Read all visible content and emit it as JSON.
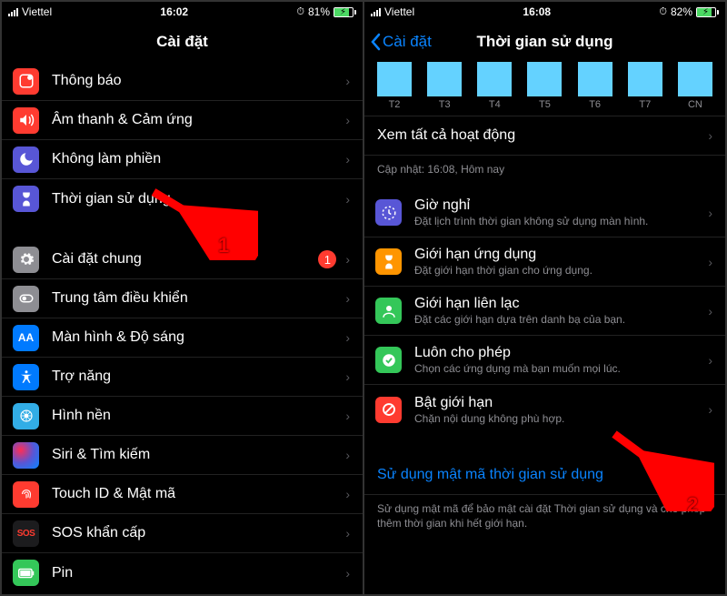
{
  "leftPhone": {
    "status": {
      "carrier": "Viettel",
      "time": "16:02",
      "battery_pct": "81%",
      "battery_fill": 81
    },
    "title": "Cài đặt",
    "group1": [
      {
        "label": "Thông báo",
        "icon": "notification-icon",
        "color": "bg-red"
      },
      {
        "label": "Âm thanh & Cảm ứng",
        "icon": "sound-icon",
        "color": "bg-red"
      },
      {
        "label": "Không làm phiền",
        "icon": "dnd-icon",
        "color": "bg-purple"
      },
      {
        "label": "Thời gian sử dụng",
        "icon": "screentime-icon",
        "color": "bg-purple"
      }
    ],
    "group2": [
      {
        "label": "Cài đặt chung",
        "icon": "gear-icon",
        "color": "bg-gray",
        "badge": "1"
      },
      {
        "label": "Trung tâm điều khiển",
        "icon": "control-icon",
        "color": "bg-gray"
      },
      {
        "label": "Màn hình & Độ sáng",
        "icon": "display-icon",
        "color": "bg-blue"
      },
      {
        "label": "Trợ năng",
        "icon": "accessibility-icon",
        "color": "bg-blue"
      },
      {
        "label": "Hình nền",
        "icon": "wallpaper-icon",
        "color": "bg-lteal"
      },
      {
        "label": "Siri & Tìm kiếm",
        "icon": "siri-icon",
        "color": "siri-icon"
      },
      {
        "label": "Touch ID & Mật mã",
        "icon": "touchid-icon",
        "color": "bg-red"
      },
      {
        "label": "SOS khẩn cấp",
        "icon": "sos-icon",
        "color": "bg-sos"
      },
      {
        "label": "Pin",
        "icon": "battery-icon",
        "color": "bg-green"
      }
    ],
    "annotation": {
      "label": "1"
    }
  },
  "rightPhone": {
    "status": {
      "carrier": "Viettel",
      "time": "16:08",
      "battery_pct": "82%",
      "battery_fill": 82
    },
    "back_label": "Cài đặt",
    "title": "Thời gian sử dụng",
    "chart": {
      "days": [
        "T2",
        "T3",
        "T4",
        "T5",
        "T6",
        "T7",
        "CN"
      ]
    },
    "view_all": "Xem tất cả hoạt động",
    "updated": "Cập nhật: 16:08, Hôm nay",
    "options": [
      {
        "label": "Giờ nghỉ",
        "sub": "Đặt lịch trình thời gian không sử dụng màn hình.",
        "icon": "downtime-icon",
        "color": "bg-purple"
      },
      {
        "label": "Giới hạn ứng dụng",
        "sub": "Đặt giới hạn thời gian cho ứng dụng.",
        "icon": "applimits-icon",
        "color": "bg-orange"
      },
      {
        "label": "Giới hạn liên lạc",
        "sub": "Đặt các giới hạn dựa trên danh bạ của bạn.",
        "icon": "commlimits-icon",
        "color": "bg-green"
      },
      {
        "label": "Luôn cho phép",
        "sub": "Chọn các ứng dụng mà bạn muốn mọi lúc.",
        "icon": "allowed-icon",
        "color": "bg-green"
      },
      {
        "label": "Bật giới hạn",
        "sub": "Chặn nội dung không phù hợp.",
        "icon": "restrict-icon",
        "color": "bg-red"
      }
    ],
    "passcode_link": "Sử dụng mật mã thời gian sử dụng",
    "passcode_note": "Sử dụng mật mã để bảo mật cài đặt Thời gian sử dụng và cho phép thêm thời gian khi hết giới hạn.",
    "annotation": {
      "label": "2"
    }
  }
}
